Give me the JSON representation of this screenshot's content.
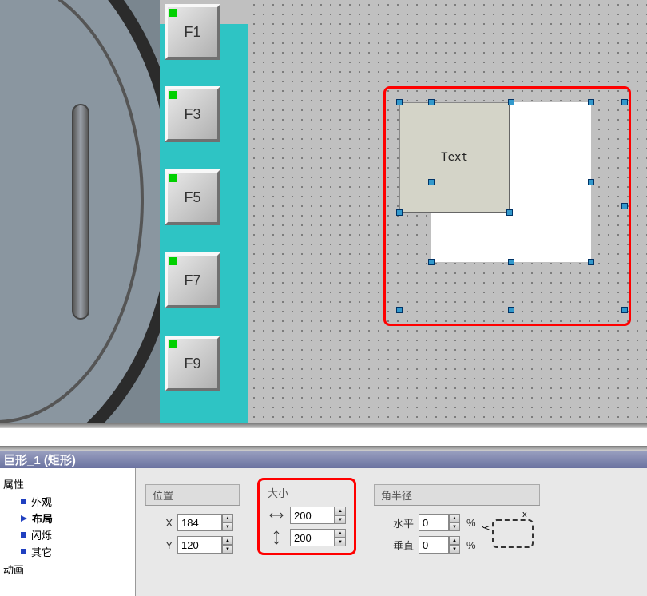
{
  "canvas": {
    "function_buttons": [
      "F1",
      "F3",
      "F5",
      "F7",
      "F9"
    ],
    "text_element_label": "Text"
  },
  "property_panel": {
    "title": "巨形_1 (矩形)",
    "tree": {
      "root": "属性",
      "items": [
        {
          "label": "外观",
          "selected": false
        },
        {
          "label": "布局",
          "selected": true
        },
        {
          "label": "闪烁",
          "selected": false
        },
        {
          "label": "其它",
          "selected": false
        }
      ],
      "root2": "动画"
    },
    "position": {
      "label": "位置",
      "x_label": "X",
      "x_value": "184",
      "y_label": "Y",
      "y_value": "120"
    },
    "size": {
      "label": "大小",
      "w_value": "200",
      "h_value": "200"
    },
    "radius": {
      "label": "角半径",
      "h_label": "水平",
      "h_value": "0",
      "v_label": "垂直",
      "v_value": "0",
      "unit": "%",
      "axis_x": "x",
      "axis_y": "y"
    }
  }
}
